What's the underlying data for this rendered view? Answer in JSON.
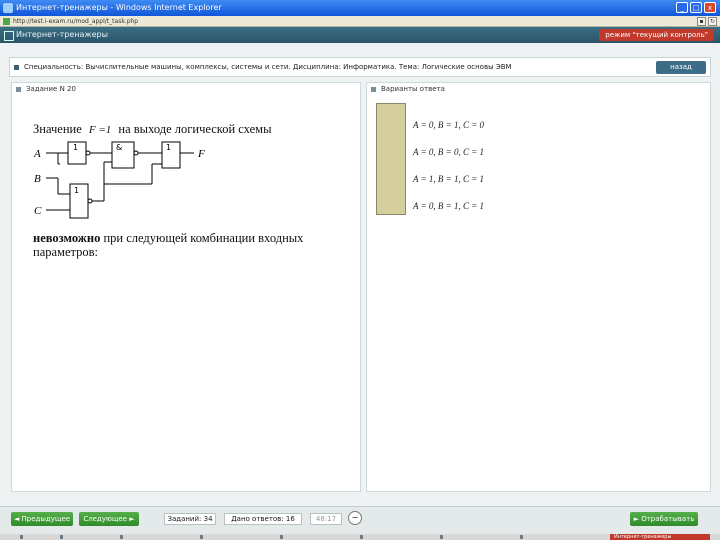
{
  "window": {
    "title": "Интернет-тренажеры - Windows Internet Explorer",
    "address": "http://test.i-exam.ru/mod_appl/t_task.php",
    "controls": [
      "_",
      "□",
      "x"
    ]
  },
  "app": {
    "name": "Интернет-тренажеры",
    "mode_badge": "режим \"текущий контроль\""
  },
  "question_bar": {
    "text": "Специальность: Вычислительные машины, комплексы, системы и сети. Дисциплина: Информатика. Тема: Логические основы ЭВМ",
    "back_label": "назад"
  },
  "task": {
    "title": "Задание N 20",
    "prompt_line1_pre": "Значение",
    "prompt_formula": "F =1",
    "prompt_line1_post": "на выходе логической схемы",
    "prompt_bold": "невозможно",
    "prompt_line2_rest": "при следующей комбинации входных",
    "prompt_line3": "параметров:",
    "circuit": {
      "inputs": [
        "A",
        "B",
        "C"
      ],
      "output": "F",
      "gate_labels": [
        "1",
        "&",
        "1",
        "1"
      ]
    }
  },
  "answers": {
    "title": "Варианты ответа",
    "options": [
      "A = 0, B = 1, C = 0",
      "A = 0, B = 0, C = 1",
      "A = 1, B = 1, C = 1",
      "A = 0, B = 1, C = 1"
    ],
    "accent_color": "#d4cf9d"
  },
  "footer": {
    "prev_label": "Предыдущее",
    "next_label": "Следующее",
    "tasks_label": "Заданий: 34",
    "answered_label": "Дано ответов: 16",
    "time_label": "48:17",
    "finish_label": "Отрабатывать"
  },
  "taskbar": {
    "active_label": "Интернет-тренажеры"
  },
  "colors": {
    "titlebar": "#0f55d8",
    "app_header": "#2b5468",
    "mode_badge": "#c0392b",
    "buttons": "#2f8a2a"
  }
}
